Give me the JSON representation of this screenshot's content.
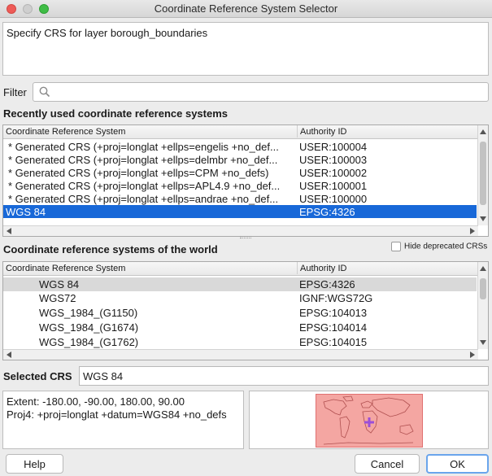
{
  "window": {
    "title": "Coordinate Reference System Selector"
  },
  "description": "Specify CRS for layer borough_boundaries",
  "filter": {
    "label": "Filter",
    "value": ""
  },
  "recent": {
    "title": "Recently used coordinate reference systems",
    "headers": [
      "Coordinate Reference System",
      "Authority ID"
    ],
    "rows": [
      {
        "name": "* Generated CRS (+proj=longlat +ellps=engelis +no_def...",
        "id": "USER:100004"
      },
      {
        "name": "* Generated CRS (+proj=longlat +ellps=delmbr +no_def...",
        "id": "USER:100003"
      },
      {
        "name": "* Generated CRS (+proj=longlat +ellps=CPM +no_defs)",
        "id": "USER:100002"
      },
      {
        "name": "* Generated CRS (+proj=longlat +ellps=APL4.9 +no_def...",
        "id": "USER:100001"
      },
      {
        "name": "* Generated CRS (+proj=longlat +ellps=andrae +no_def...",
        "id": "USER:100000"
      },
      {
        "name": "WGS 84",
        "id": "EPSG:4326"
      }
    ]
  },
  "world": {
    "title": "Coordinate reference systems of the world",
    "hide_deprecated_label": "Hide deprecated CRSs",
    "hide_deprecated_checked": false,
    "headers": [
      "Coordinate Reference System",
      "Authority ID"
    ],
    "rows": [
      {
        "name": "WGS 84",
        "id": "EPSG:4326"
      },
      {
        "name": "WGS72",
        "id": "IGNF:WGS72G"
      },
      {
        "name": "WGS_1984_(G1150)",
        "id": "EPSG:104013"
      },
      {
        "name": "WGS_1984_(G1674)",
        "id": "EPSG:104014"
      },
      {
        "name": "WGS_1984_(G1762)",
        "id": "EPSG:104015"
      }
    ]
  },
  "selected": {
    "label": "Selected CRS",
    "value": "WGS 84"
  },
  "info": {
    "extent": "Extent: -180.00, -90.00, 180.00, 90.00",
    "proj4": "Proj4: +proj=longlat +datum=WGS84 +no_defs"
  },
  "buttons": {
    "help": "Help",
    "cancel": "Cancel",
    "ok": "OK"
  },
  "colors": {
    "selection": "#1868d8",
    "ok_border": "#4a90e2",
    "extent_fill": "#f08080"
  }
}
